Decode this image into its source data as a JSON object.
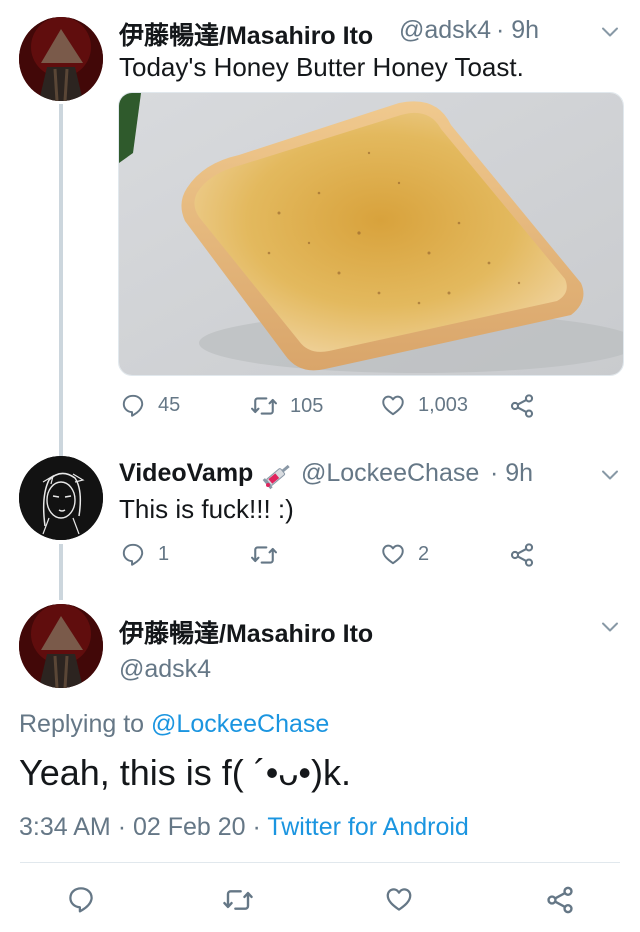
{
  "tweet1": {
    "display_name": "伊藤暢達/Masahiro Ito",
    "handle": "@adsk4",
    "time": "· 9h",
    "text": "Today's Honey Butter Honey Toast.",
    "replies": "45",
    "retweets": "105",
    "likes": "1,003"
  },
  "tweet2": {
    "display_name": "VideoVamp",
    "handle": "@LockeeChase",
    "time": "· 9h",
    "text": "This is fuck!!! :)",
    "replies": "1",
    "retweets": "",
    "likes": "2"
  },
  "tweet3": {
    "display_name": "伊藤暢達/Masahiro Ito",
    "handle": "@adsk4",
    "replying_prefix": "Replying to",
    "replying_to": "@LockeeChase",
    "text": "Yeah, this is f( ´•ᴗ•)k.",
    "time": "3:34 AM",
    "date": "· 02 Feb 20 ·",
    "source": "Twitter for Android"
  },
  "colors": {
    "accent": "#1b95e0",
    "muted": "#657786",
    "line": "#ccd6dd",
    "text": "#14171a"
  },
  "icons": [
    "reply-icon",
    "retweet-icon",
    "like-icon",
    "share-icon",
    "chevron-down-icon",
    "syringe-emoji-icon"
  ]
}
